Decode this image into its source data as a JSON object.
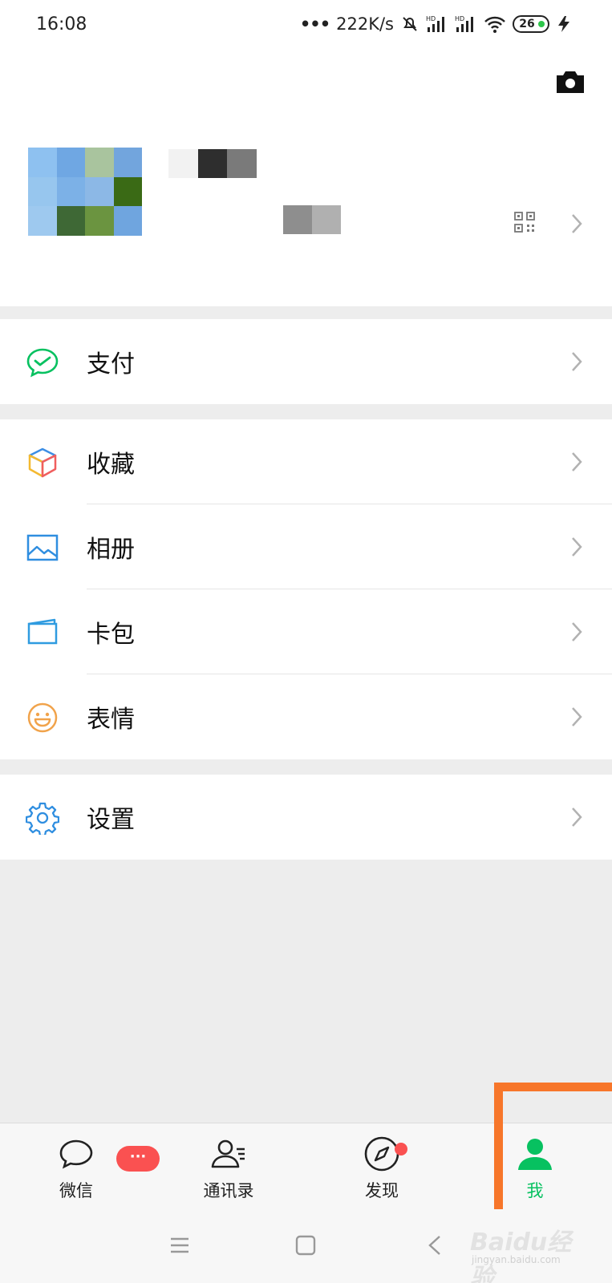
{
  "status_bar": {
    "time": "16:08",
    "network_speed": "222K/s",
    "battery": "26"
  },
  "profile": {
    "avatar_colors": [
      "#8ec1f0",
      "#6fa7e3",
      "#a9c49e",
      "#72a5dd",
      "#97c6ee",
      "#7cb1e7",
      "#8cb8e6",
      "#3a6a15",
      "#9ec9ef",
      "#3e6835",
      "#6b9440",
      "#6fa5df"
    ],
    "nickname_colors": [
      "#f2f2f2",
      "#2e2e2e",
      "#7a7a7a"
    ],
    "id_colors": [
      "#8e8e8e",
      "#b0b0b0"
    ]
  },
  "menu": {
    "pay": {
      "label": "支付",
      "icon": "wechat-pay-icon"
    },
    "favorites": {
      "label": "收藏",
      "icon": "cube-icon"
    },
    "album": {
      "label": "相册",
      "icon": "image-icon"
    },
    "cards": {
      "label": "卡包",
      "icon": "card-wallet-icon"
    },
    "stickers": {
      "label": "表情",
      "icon": "smiley-icon"
    },
    "settings": {
      "label": "设置",
      "icon": "gear-icon"
    }
  },
  "tabs": [
    {
      "label": "微信",
      "badge": "···"
    },
    {
      "label": "通讯录"
    },
    {
      "label": "发现"
    },
    {
      "label": "我"
    }
  ],
  "accent_color": "#07c160",
  "watermark": {
    "main": "Baidu经验",
    "sub": "jingyan.baidu.com"
  }
}
